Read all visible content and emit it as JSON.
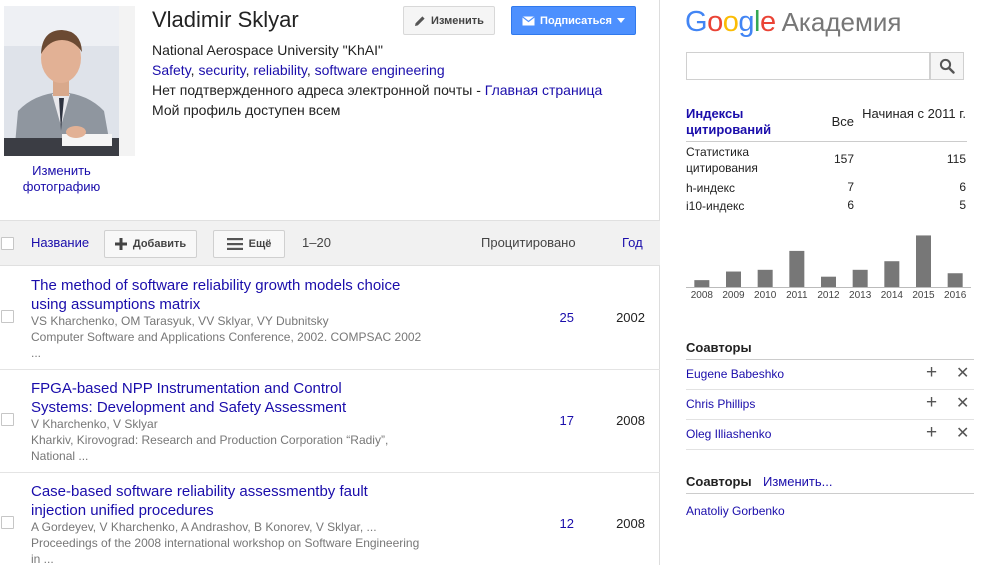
{
  "profile": {
    "name": "Vladimir Sklyar",
    "change_photo": "Изменить фотографию",
    "affiliation": "National Aerospace University \"KhAI\"",
    "interests": [
      "Safety",
      "security",
      "reliability",
      "software engineering"
    ],
    "email_status": "Нет подтвержденного адреса электронной почты",
    "homepage_link": "Главная страница",
    "visibility": "Мой профиль доступен всем",
    "edit_button": "Изменить",
    "follow_button": "Подписаться"
  },
  "toolbar": {
    "title_col": "Название",
    "add_button": "Добавить",
    "more_button": "Ещё",
    "range": "1–20",
    "cited_col": "Процитировано",
    "year_col": "Год"
  },
  "articles": [
    {
      "title": "The method of software reliability growth models choice using assumptions matrix",
      "authors": "VS Kharchenko, OM Tarasyuk, VV Sklyar, VY Dubnitsky",
      "venue": "Computer Software and Applications Conference, 2002. COMPSAC 2002 ...",
      "cited": "25",
      "year": "2002"
    },
    {
      "title": "FPGA-based NPP Instrumentation and Control Systems: Development and Safety Assessment",
      "authors": "V Kharchenko, V Sklyar",
      "venue": "Kharkiv, Kirovograd: Research and Production Corporation “Radiy”, National ...",
      "cited": "17",
      "year": "2008"
    },
    {
      "title": "Case-based software reliability assessmentby fault injection unified procedures",
      "authors": "A Gordeyev, V Kharchenko, A Andrashov, B Konorev, V Sklyar, ...",
      "venue": "Proceedings of the 2008 international workshop on Software Engineering in ...",
      "cited": "12",
      "year": "2008"
    }
  ],
  "sidebar": {
    "logo_google": "Google",
    "logo_academy": "Академия",
    "search_placeholder": "",
    "citation": {
      "header": "Индексы цитирований",
      "col_all": "Все",
      "col_since": "Начиная с 2011 г.",
      "rows": [
        {
          "label": "Статистика цитирования",
          "all": "157",
          "since": "115"
        },
        {
          "label": "h-индекс",
          "all": "7",
          "since": "6"
        },
        {
          "label": "i10-индекс",
          "all": "6",
          "since": "5"
        }
      ]
    },
    "coauthors_title": "Соавторы",
    "coauthors": [
      "Eugene Babeshko",
      "Chris Phillips",
      "Oleg Illiashenko"
    ],
    "coauthors_title2": "Соавторы",
    "coauthors_edit": "Изменить...",
    "coauthors2": [
      "Anatoliy Gorbenko"
    ]
  },
  "colors": {
    "link": "#1a0dab",
    "follow_button": "#4d90fe",
    "bar": "#777777"
  },
  "chart_data": {
    "type": "bar",
    "categories": [
      "2008",
      "2009",
      "2010",
      "2011",
      "2012",
      "2013",
      "2014",
      "2015",
      "2016"
    ],
    "values": [
      4,
      9,
      10,
      21,
      6,
      10,
      15,
      30,
      8
    ],
    "title": "",
    "xlabel": "",
    "ylabel": "",
    "ylim": [
      0,
      32
    ]
  }
}
